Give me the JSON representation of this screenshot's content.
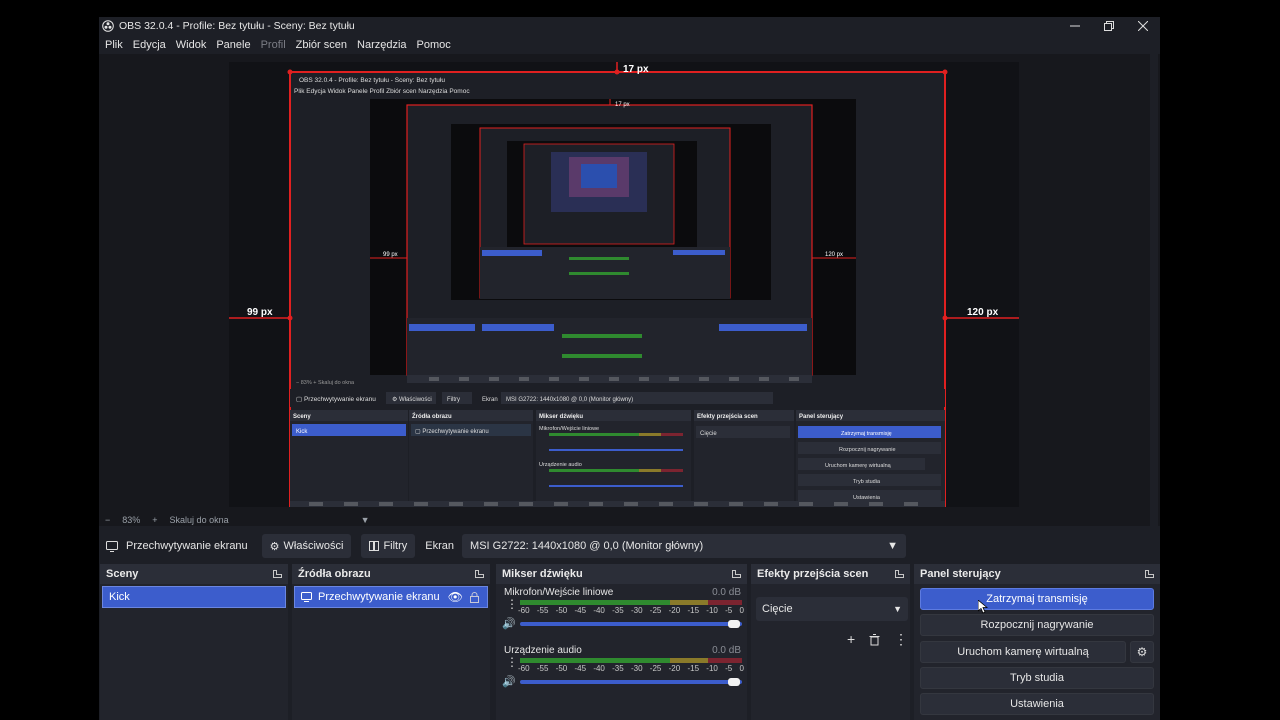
{
  "window": {
    "title": "OBS 32.0.4 - Profile: Bez tytułu - Sceny: Bez tytułu"
  },
  "menu": [
    "Plik",
    "Edycja",
    "Widok",
    "Panele",
    "Profil",
    "Zbiór scen",
    "Narzędzia",
    "Pomoc"
  ],
  "preview": {
    "top_label": "17 px",
    "left_label": "99 px",
    "right_label": "120 px",
    "inner_title": "OBS 32.0.4 - Profile: Bez tytułu - Sceny: Bez tytułu",
    "inner_menu": [
      "Plik",
      "Edycja",
      "Widok",
      "Panele",
      "Profil",
      "Zbiór scen",
      "Narzędzia",
      "Pomoc"
    ]
  },
  "zoom": {
    "minus": "−",
    "level": "83%",
    "plus": "+",
    "fit_label": "Skaluj do okna"
  },
  "source_toolbar": {
    "source_name": "Przechwytywanie ekranu",
    "properties_label": "Właściwości",
    "filters_label": "Filtry",
    "screen_label": "Ekran",
    "screen_value": "MSI G2722: 1440x1080 @ 0,0 (Monitor główny)"
  },
  "scenes": {
    "title": "Sceny",
    "items": [
      "Kick"
    ]
  },
  "sources": {
    "title": "Źródła obrazu",
    "items": [
      "Przechwytywanie ekranu"
    ]
  },
  "mixer": {
    "title": "Mikser dźwięku",
    "scale": [
      "-60",
      "-55",
      "-50",
      "-45",
      "-40",
      "-35",
      "-30",
      "-25",
      "-20",
      "-15",
      "-10",
      "-5",
      "0"
    ],
    "channels": [
      {
        "name": "Mikrofon/Wejście liniowe",
        "db": "0.0 dB",
        "volume": 1.0
      },
      {
        "name": "Urządzenie audio",
        "db": "0.0 dB",
        "volume": 1.0
      }
    ]
  },
  "transitions": {
    "title": "Efekty przejścia scen",
    "selected": "Cięcie"
  },
  "controls": {
    "title": "Panel sterujący",
    "stop_stream": "Zatrzymaj transmisję",
    "start_recording": "Rozpocznij nagrywanie",
    "virtual_camera": "Uruchom kamerę wirtualną",
    "studio_mode": "Tryb studia",
    "settings": "Ustawienia"
  },
  "colors": {
    "accent": "#3c5dcc",
    "window_bg": "#1d1f26",
    "dock_bg": "#22242c",
    "dock_header": "#2b2e38",
    "bounding_red": "#e02020"
  }
}
